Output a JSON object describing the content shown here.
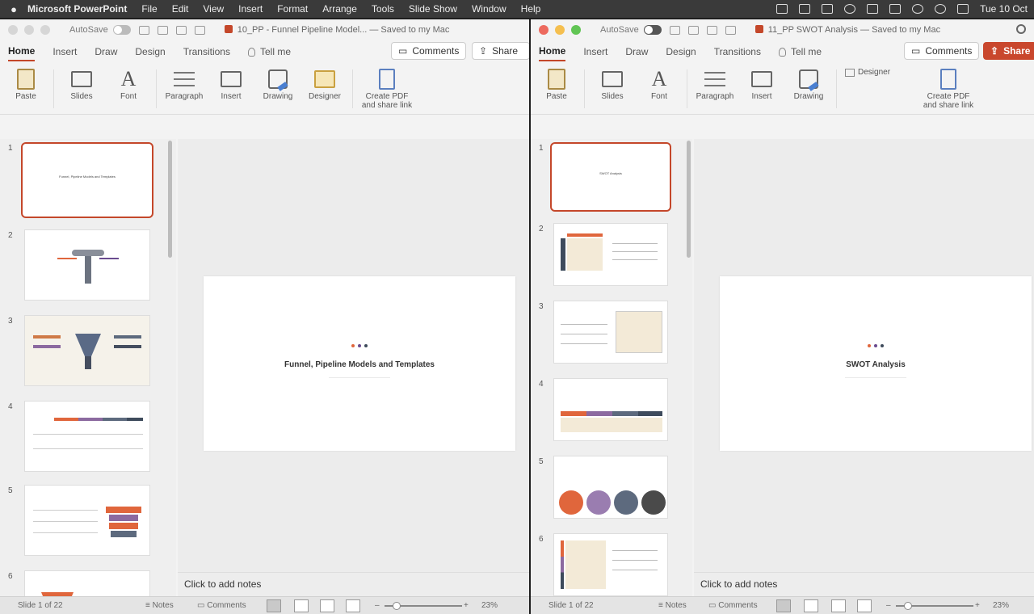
{
  "menubar": {
    "app_name": "Microsoft PowerPoint",
    "items": [
      "File",
      "Edit",
      "View",
      "Insert",
      "Format",
      "Arrange",
      "Tools",
      "Slide Show",
      "Window",
      "Help"
    ],
    "clock": "Tue 10 Oct"
  },
  "left_window": {
    "autosave_label": "AutoSave",
    "doc_title": "10_PP - Funnel Pipeline Model... — Saved to my Mac",
    "tabs": [
      "Home",
      "Insert",
      "Draw",
      "Design",
      "Transitions"
    ],
    "tell_me": "Tell me",
    "comments_label": "Comments",
    "share_label": "Share",
    "ribbon": [
      "Paste",
      "Slides",
      "Font",
      "Paragraph",
      "Insert",
      "Drawing",
      "Designer",
      "Create PDF\nand share link"
    ],
    "thumb_numbers": [
      "1",
      "2",
      "3",
      "4",
      "5",
      "6"
    ],
    "slide_title": "Funnel, Pipeline Models and Templates",
    "notes_placeholder": "Click to add notes",
    "status": "Slide 1 of 22",
    "notes_btn": "Notes",
    "comments_btn": "Comments",
    "zoom": "23%"
  },
  "right_window": {
    "autosave_label": "AutoSave",
    "doc_title": "11_PP SWOT Analysis — Saved to my Mac",
    "tabs": [
      "Home",
      "Insert",
      "Draw",
      "Design",
      "Transitions"
    ],
    "tell_me": "Tell me",
    "comments_label": "Comments",
    "share_label": "Share",
    "ribbon": [
      "Paste",
      "Slides",
      "Font",
      "Paragraph",
      "Insert",
      "Drawing",
      "Designer",
      "Create PDF\nand share link"
    ],
    "thumb_numbers": [
      "1",
      "2",
      "3",
      "4",
      "5",
      "6"
    ],
    "slide_title": "SWOT Analysis",
    "notes_placeholder": "Click to add notes",
    "status": "Slide 1 of 22",
    "notes_btn": "Notes",
    "comments_btn": "Comments",
    "zoom": "23%"
  },
  "colors": {
    "accent": "#c4472a",
    "dot1": "#e0663c",
    "dot2": "#6a4b8f",
    "dot3": "#3e4b5c"
  }
}
